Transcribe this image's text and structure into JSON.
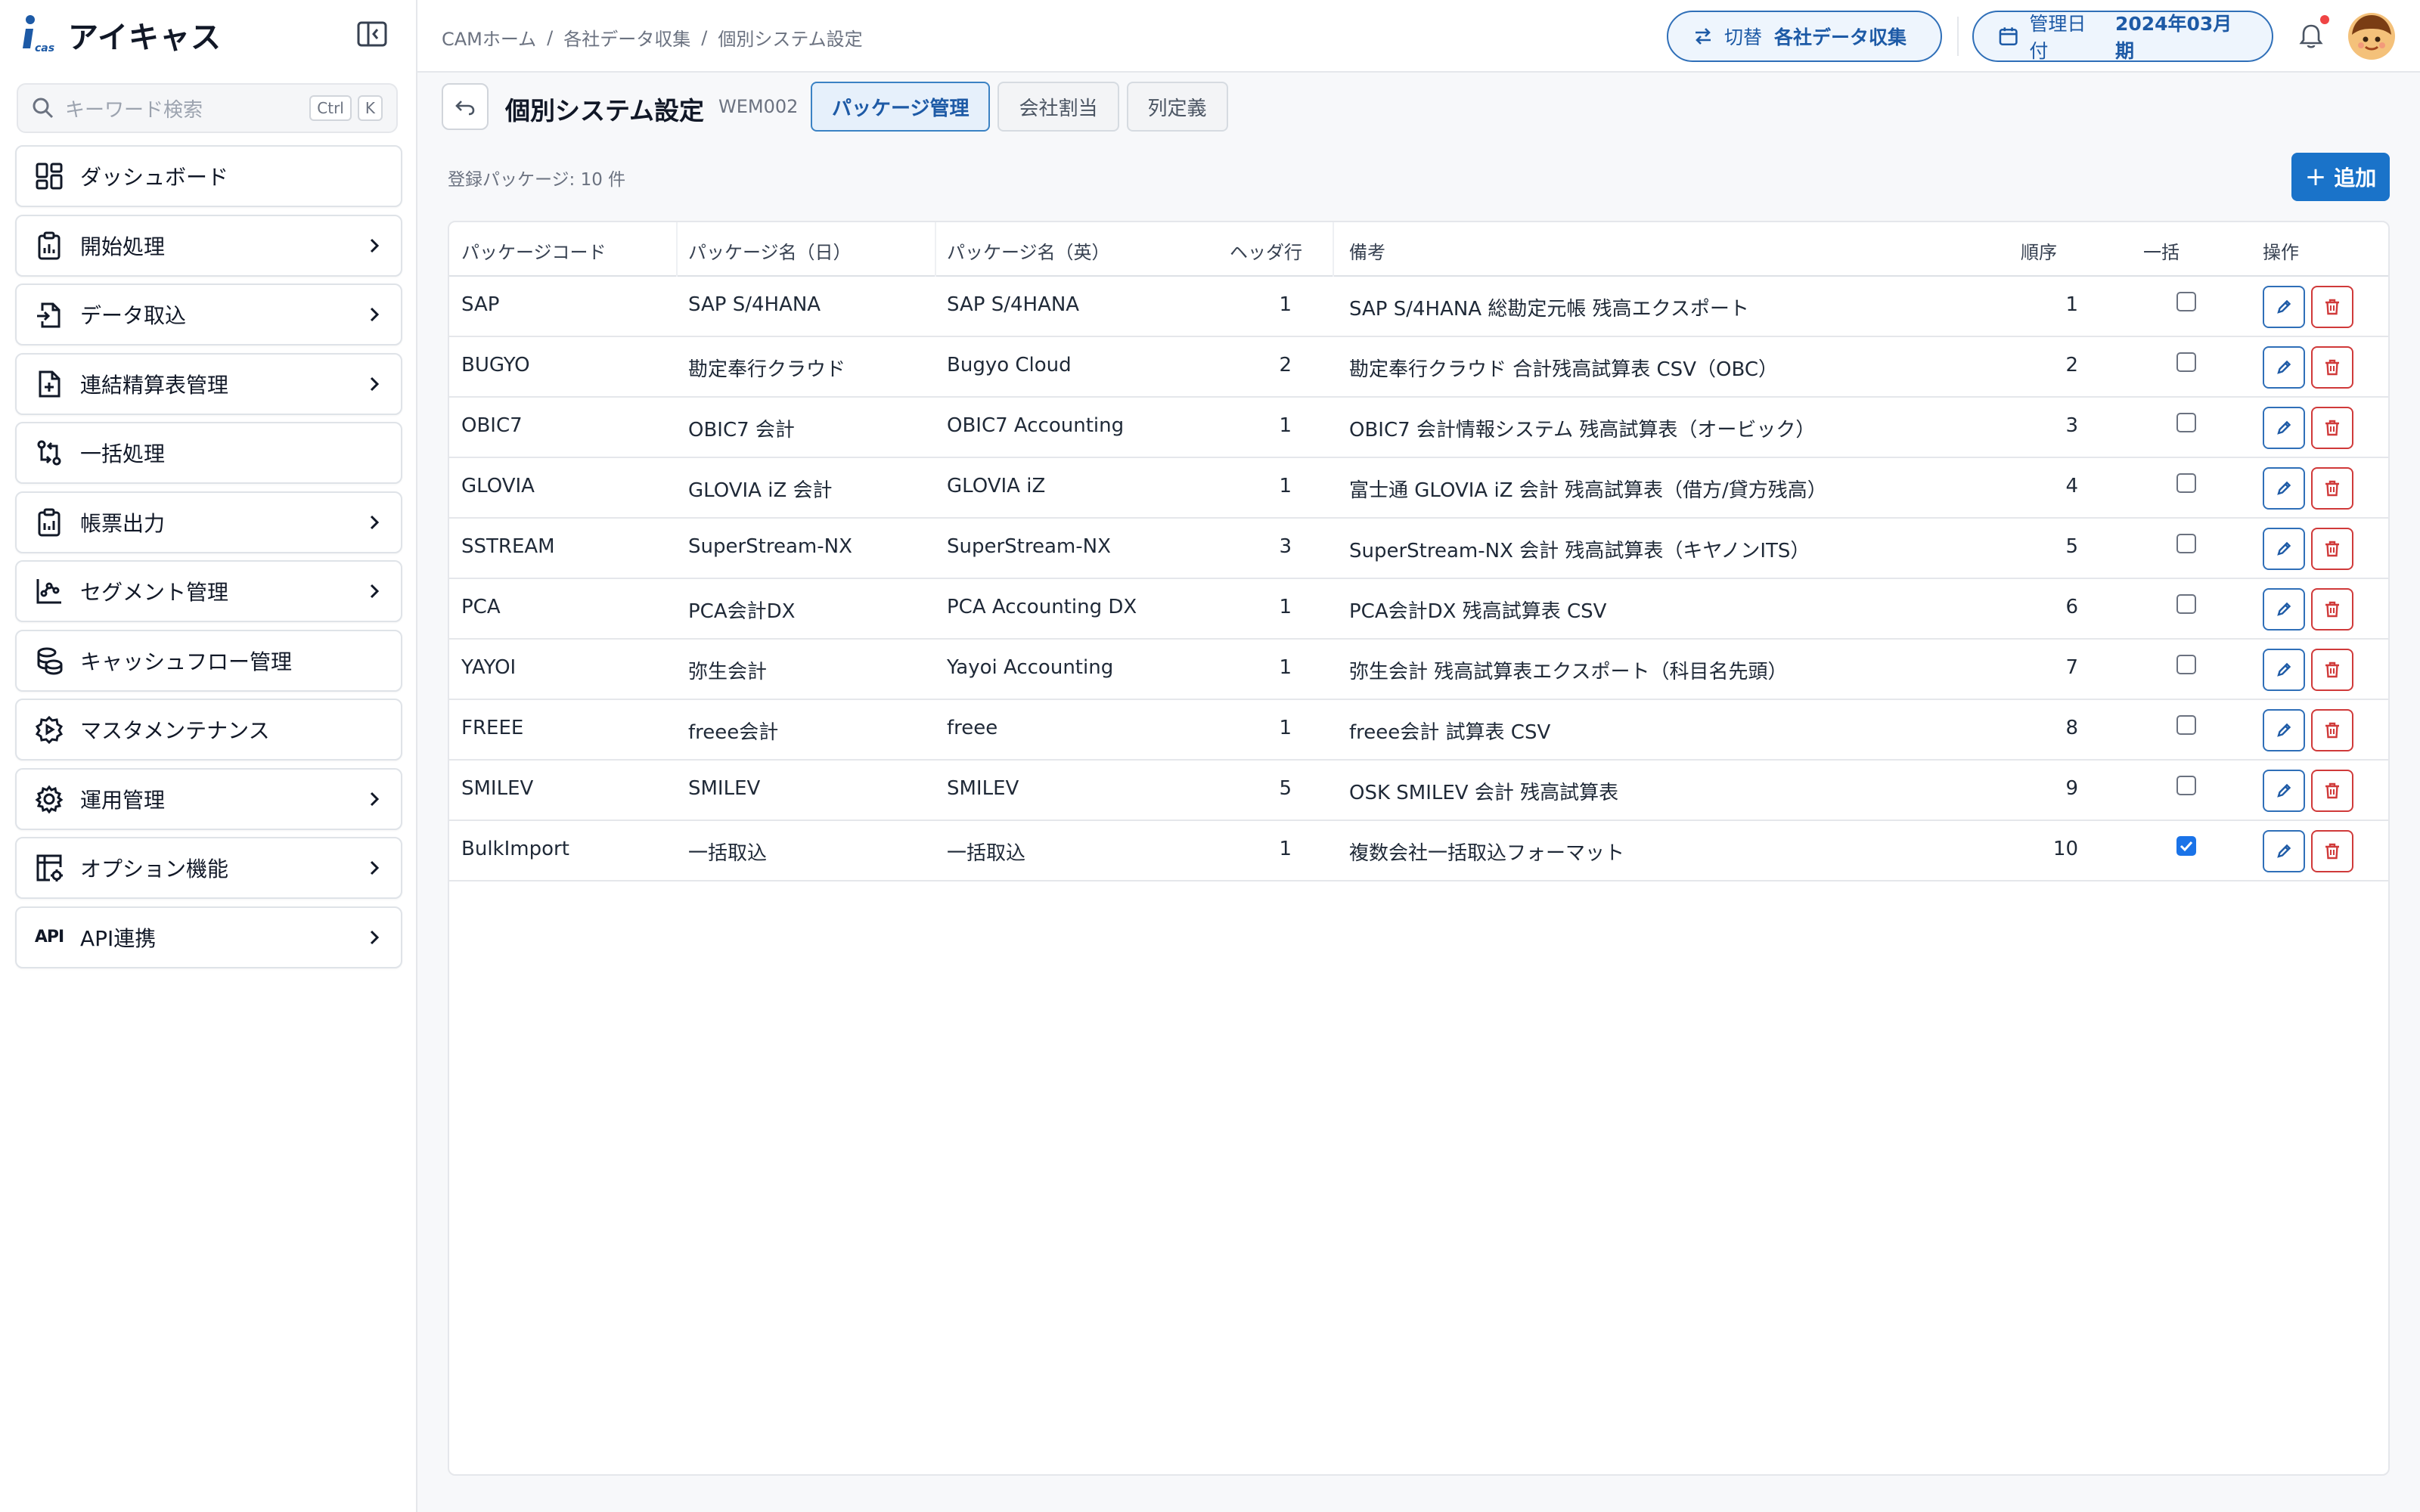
{
  "brand": {
    "name": "アイキャス",
    "logo_text": "ICAS"
  },
  "search": {
    "placeholder": "キーワード検索",
    "shortcut_mod": "Ctrl",
    "shortcut_key": "K"
  },
  "sidebar": {
    "items": [
      {
        "label": "ダッシュボード",
        "icon": "dashboard-icon",
        "chevron": false
      },
      {
        "label": "開始処理",
        "icon": "clipboard-chart-icon",
        "chevron": true
      },
      {
        "label": "データ取込",
        "icon": "file-import-icon",
        "chevron": true
      },
      {
        "label": "連結精算表管理",
        "icon": "file-plus-icon",
        "chevron": true
      },
      {
        "label": "一括処理",
        "icon": "git-compare-icon",
        "chevron": false
      },
      {
        "label": "帳票出力",
        "icon": "clipboard-report-icon",
        "chevron": true
      },
      {
        "label": "セグメント管理",
        "icon": "segment-chart-icon",
        "chevron": true
      },
      {
        "label": "キャッシュフロー管理",
        "icon": "coins-icon",
        "chevron": false
      },
      {
        "label": "マスタメンテナンス",
        "icon": "settings-cog-icon",
        "chevron": false
      },
      {
        "label": "運用管理",
        "icon": "gear-icon",
        "chevron": true
      },
      {
        "label": "オプション機能",
        "icon": "grid-settings-icon",
        "chevron": true
      },
      {
        "label": "API連携",
        "icon": "api-icon",
        "icon_text": "API",
        "chevron": true
      }
    ]
  },
  "breadcrumb": [
    "CAMホーム",
    "各社データ収集",
    "個別システム設定"
  ],
  "header": {
    "switch_key": "切替",
    "switch_value": "各社データ収集",
    "date_key": "管理日付",
    "date_value": "2024年03月期"
  },
  "page": {
    "title": "個別システム設定",
    "code": "WEM002",
    "tabs": [
      "パッケージ管理",
      "会社割当",
      "列定義"
    ],
    "active_tab": 0,
    "count_label": "登録パッケージ: 10 件",
    "add_label": "追加"
  },
  "table": {
    "columns": [
      "パッケージコード",
      "パッケージ名（日）",
      "パッケージ名（英）",
      "ヘッダ行",
      "備考",
      "順序",
      "一括",
      "操作"
    ],
    "rows": [
      {
        "code": "SAP",
        "name_ja": "SAP S/4HANA",
        "name_en": "SAP S/4HANA",
        "header_rows": "1",
        "note": "SAP S/4HANA 総勘定元帳 残高エクスポート",
        "order": "1",
        "bulk": false
      },
      {
        "code": "BUGYO",
        "name_ja": "勘定奉行クラウド",
        "name_en": "Bugyo Cloud",
        "header_rows": "2",
        "note": "勘定奉行クラウド 合計残高試算表 CSV（OBC）",
        "order": "2",
        "bulk": false
      },
      {
        "code": "OBIC7",
        "name_ja": "OBIC7 会計",
        "name_en": "OBIC7 Accounting",
        "header_rows": "1",
        "note": "OBIC7 会計情報システム 残高試算表（オービック）",
        "order": "3",
        "bulk": false
      },
      {
        "code": "GLOVIA",
        "name_ja": "GLOVIA iZ 会計",
        "name_en": "GLOVIA iZ",
        "header_rows": "1",
        "note": "富士通 GLOVIA iZ 会計 残高試算表（借方/貸方残高）",
        "order": "4",
        "bulk": false
      },
      {
        "code": "SSTREAM",
        "name_ja": "SuperStream-NX",
        "name_en": "SuperStream-NX",
        "header_rows": "3",
        "note": "SuperStream-NX 会計 残高試算表（キヤノンITS）",
        "order": "5",
        "bulk": false
      },
      {
        "code": "PCA",
        "name_ja": "PCA会計DX",
        "name_en": "PCA Accounting DX",
        "header_rows": "1",
        "note": "PCA会計DX 残高試算表 CSV",
        "order": "6",
        "bulk": false
      },
      {
        "code": "YAYOI",
        "name_ja": "弥生会計",
        "name_en": "Yayoi Accounting",
        "header_rows": "1",
        "note": "弥生会計 残高試算表エクスポート（科目名先頭）",
        "order": "7",
        "bulk": false
      },
      {
        "code": "FREEE",
        "name_ja": "freee会計",
        "name_en": "freee",
        "header_rows": "1",
        "note": "freee会計 試算表 CSV",
        "order": "8",
        "bulk": false
      },
      {
        "code": "SMILEV",
        "name_ja": "SMILEV",
        "name_en": "SMILEV",
        "header_rows": "5",
        "note": "OSK SMILEV 会計 残高試算表",
        "order": "9",
        "bulk": false
      },
      {
        "code": "BulkImport",
        "name_ja": "一括取込",
        "name_en": "一括取込",
        "header_rows": "1",
        "note": "複数会社一括取込フォーマット",
        "order": "10",
        "bulk": true
      }
    ]
  },
  "colors": {
    "accent": "#1a73c9",
    "danger": "#d03a3a",
    "notification": "#ef4444"
  }
}
